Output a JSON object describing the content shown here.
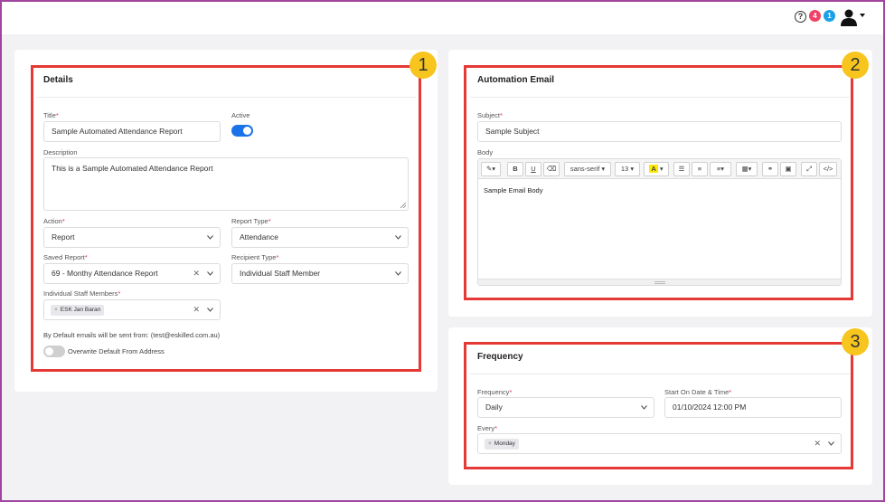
{
  "header": {
    "help_glyph": "?",
    "notifications_count": "4",
    "messages_count": "1",
    "help_icon": "question-circle-icon",
    "user_icon": "user-icon"
  },
  "details": {
    "title": "Details",
    "title_label": "Title",
    "title_value": "Sample Automated Attendance Report",
    "active_label": "Active",
    "active_on": true,
    "description_label": "Description",
    "description_value": "This is a Sample Automated Attendance Report",
    "action_label": "Action",
    "action_value": "Report",
    "report_type_label": "Report Type",
    "report_type_value": "Attendance",
    "saved_report_label": "Saved Report",
    "saved_report_value": "69 - Monthy Attendance Report",
    "recipient_type_label": "Recipient Type",
    "recipient_type_value": "Individual Staff Member",
    "staff_label": "Individual Staff Members",
    "staff_tags": [
      "ESK Jan Baran"
    ],
    "sender_note": "By Default emails will be sent from: (test@eskilled.com.au)",
    "overwrite_label": "Overwrite Default From Address",
    "overwrite_on": false
  },
  "automation_email": {
    "title": "Automation Email",
    "subject_label": "Subject",
    "subject_value": "Sample Subject",
    "body_label": "Body",
    "body_value": "Sample Email Body",
    "toolbar": {
      "font_family": "sans-serif",
      "font_size": "13",
      "bold": "B",
      "underline": "U",
      "color_letter": "A",
      "code_view": "</>"
    }
  },
  "frequency": {
    "title": "Frequency",
    "frequency_label": "Frequency",
    "frequency_value": "Daily",
    "start_label": "Start On Date & Time",
    "start_value": "01/10/2024 12:00 PM",
    "every_label": "Every",
    "every_tags": [
      "Monday"
    ]
  },
  "callouts": [
    "1",
    "2",
    "3"
  ],
  "colors": {
    "highlight": "#e53935",
    "callout": "#f7c51e",
    "toggle_active": "#1a73e8",
    "required": "#e0344a"
  }
}
